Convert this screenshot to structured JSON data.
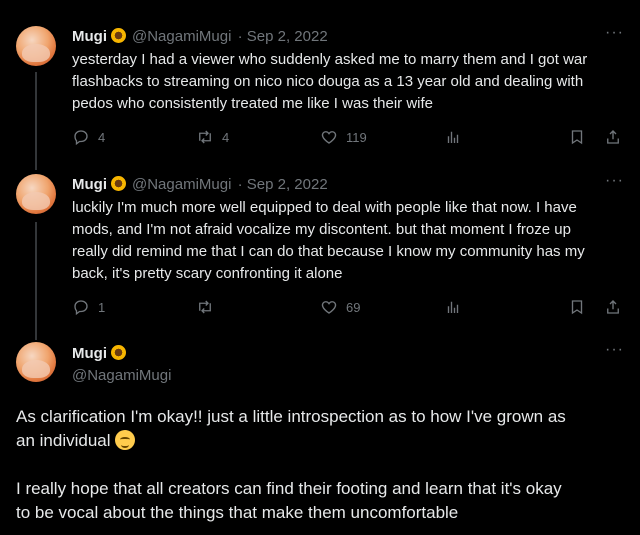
{
  "tweets": [
    {
      "name": "Mugi",
      "handle": "@NagamiMugi",
      "date": "· Sep 2, 2022",
      "more": "···",
      "text_lines": [
        "yesterday I had a viewer who suddenly asked me to marry them and I got war",
        "flashbacks to streaming on nico nico douga as a 13 year old and dealing with",
        "pedos who consistently treated me like I was their wife"
      ],
      "replies": "4",
      "retweets": "4",
      "likes": "119"
    },
    {
      "name": "Mugi",
      "handle": "@NagamiMugi",
      "date": "· Sep 2, 2022",
      "more": "···",
      "text_lines": [
        "luckily I'm much more well equipped to deal with people like that now. I have",
        "mods, and I'm not afraid vocalize my discontent. but that moment I froze up",
        "really did remind me that I can do that because I know my community has my",
        "back, it's pretty scary confronting it alone"
      ],
      "replies": "1",
      "retweets": "",
      "likes": "69"
    },
    {
      "name": "Mugi",
      "handle": "@NagamiMugi",
      "more": "···",
      "text_lines": [
        "As clarification I'm okay!! just a little introspection as to how I've grown as",
        "an individual",
        "I really hope that all creators can find their footing and learn that it's okay",
        "to be vocal about the things that make them uncomfortable"
      ]
    }
  ],
  "icons": {
    "reply": "reply-icon",
    "retweet": "retweet-icon",
    "like": "heart-icon",
    "views": "views-icon",
    "bookmark": "bookmark-icon",
    "share": "share-icon",
    "verified_emoji": "sunflower-emoji",
    "relieved_emoji": "relieved-face-emoji"
  }
}
